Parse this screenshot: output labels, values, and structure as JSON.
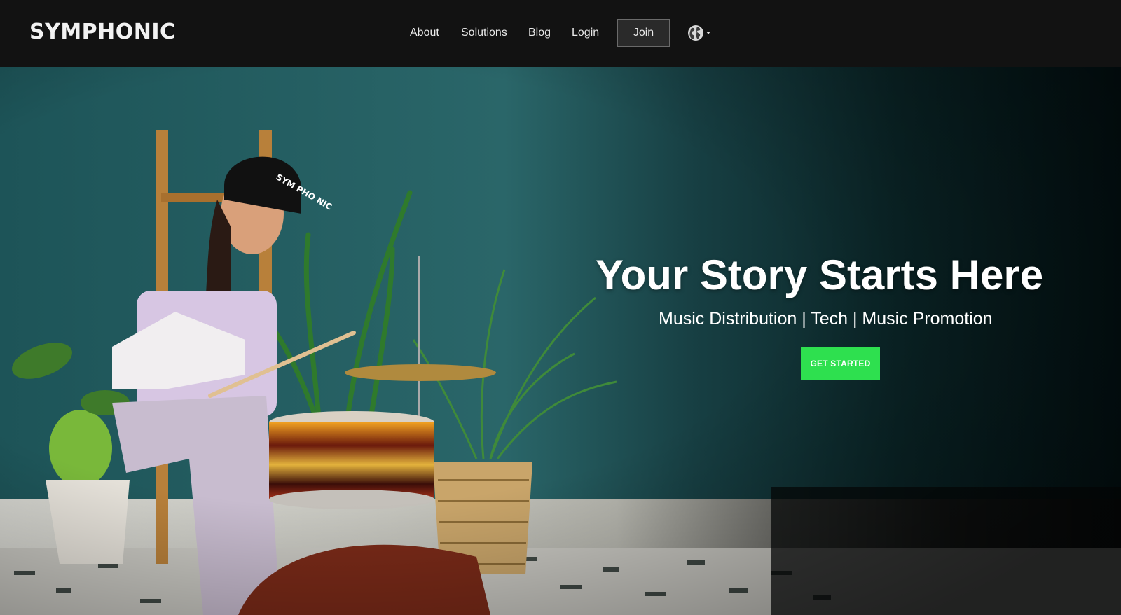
{
  "header": {
    "logo_text": "SYMPHONIC",
    "nav": {
      "about": "About",
      "solutions": "Solutions",
      "blog": "Blog",
      "login": "Login",
      "join": "Join"
    },
    "language_icon": "globe-icon"
  },
  "hero": {
    "headline": "Your Story Starts Here",
    "subheadline": "Music Distribution | Tech | Music Promotion",
    "cta_label": "GET STARTED",
    "beanie_text": "SYM PHO NIC"
  },
  "colors": {
    "header_bg": "#121212",
    "hero_wall": "#1f5f63",
    "cta_green": "#2ee04f"
  }
}
